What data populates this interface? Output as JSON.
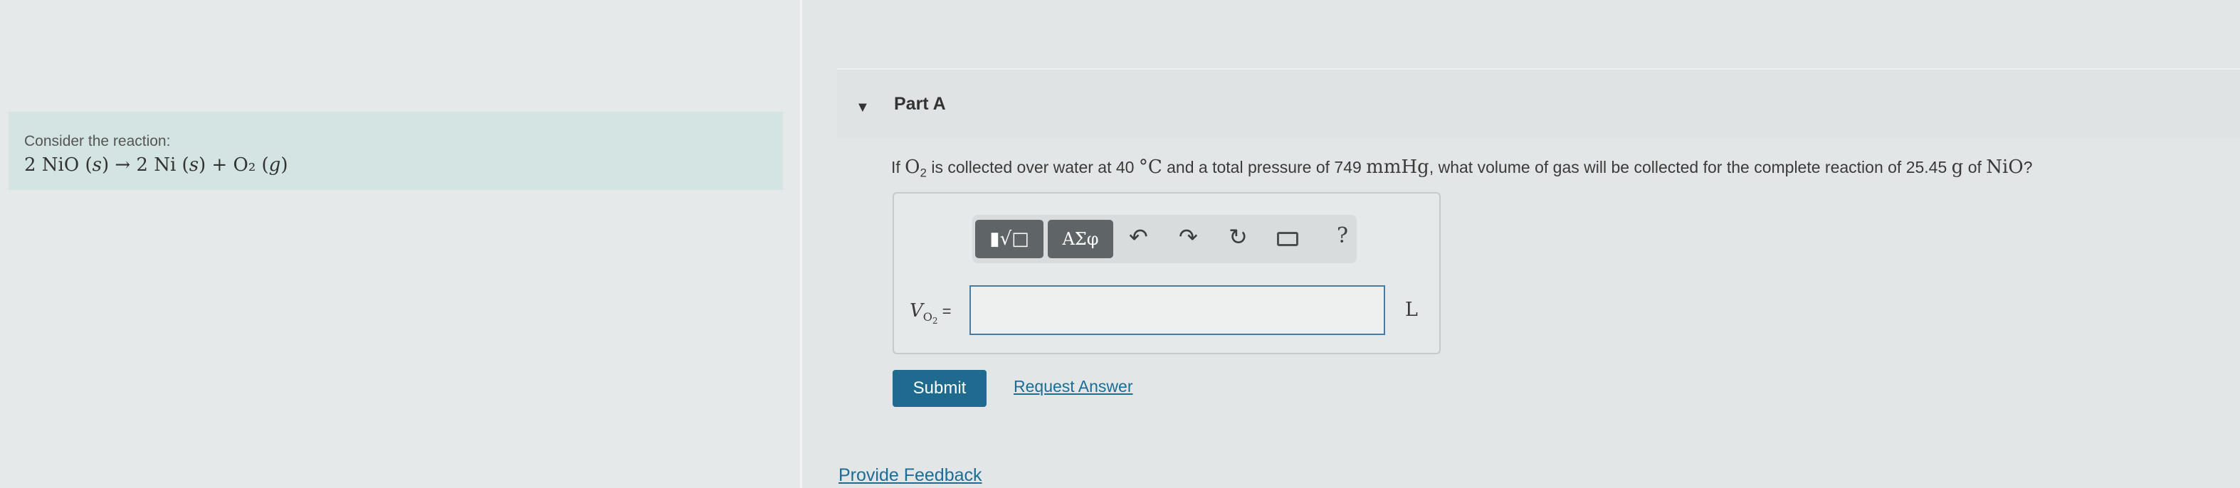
{
  "intro": {
    "label": "Consider the reaction:",
    "equation_parts": [
      "2 NiO (",
      "s",
      ") → 2 Ni (",
      "s",
      ") + O₂ (",
      "g",
      ")"
    ]
  },
  "part": {
    "title": "Part A",
    "question": {
      "prefix": "If ",
      "gas": "O",
      "gas_sub": "2",
      "mid1": " is collected over water at 40 ",
      "temp_unit": "°C",
      "mid2": " and a total pressure of 749 ",
      "pressure_unit": "mmHg",
      "mid3": ", what volume of gas will be collected for the complete reaction of 25.45 ",
      "mass_unit": "g",
      "mid4": " of ",
      "compound": "NiO",
      "suffix": "?"
    }
  },
  "toolbar": {
    "templates_label": "▮√□",
    "symbols_label": "ΑΣφ",
    "undo_icon": "↶",
    "redo_icon": "↷",
    "reset_icon": "↻",
    "help_label": "?"
  },
  "answer": {
    "var_main": "V",
    "var_sub": "O",
    "var_sub2": "2",
    "equals": " =",
    "value": "",
    "unit": "L"
  },
  "actions": {
    "submit_label": "Submit",
    "request_answer_label": "Request Answer",
    "feedback_label": "Provide Feedback"
  }
}
